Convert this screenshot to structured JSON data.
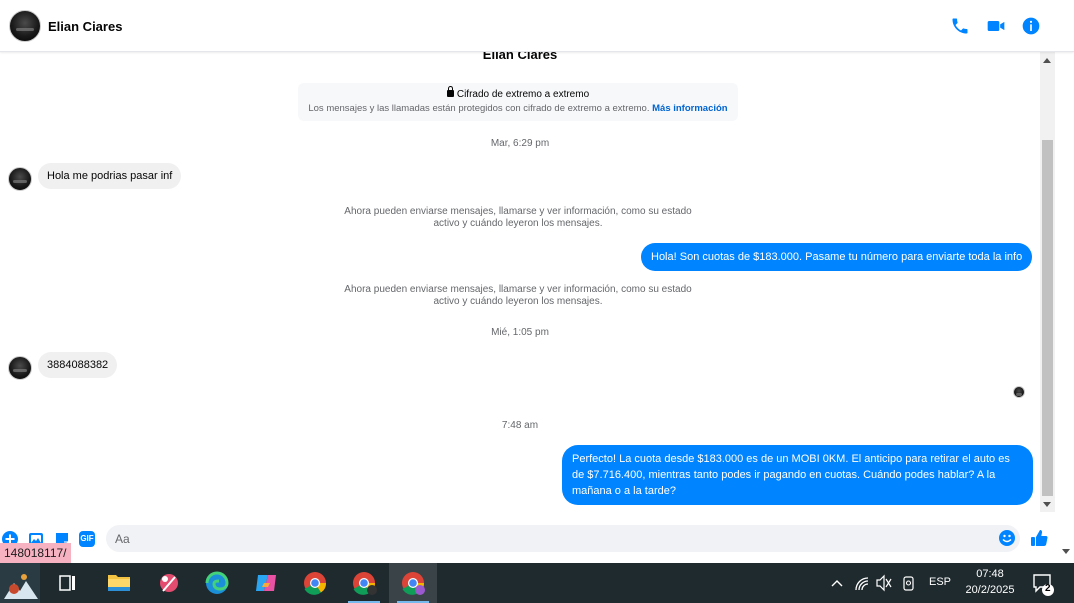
{
  "header": {
    "contact_name": "Elian Ciares",
    "icons": [
      "phone-icon",
      "video-camera-icon",
      "info-icon"
    ],
    "accent_color": "#0084ff"
  },
  "conversation": {
    "name": "Elian Ciares",
    "encryption": {
      "title": "Cifrado de extremo a extremo",
      "description": "Los mensajes y las llamadas están protegidos con cifrado de extremo a extremo.",
      "link": "Más información"
    },
    "timestamps": [
      "Mar, 6:29 pm",
      "Mié, 1:05 pm",
      "7:48 am"
    ],
    "system_notices": [
      "Ahora pueden enviarse mensajes, llamarse y ver información, como su estado activo y cuándo leyeron los mensajes.",
      "Ahora pueden enviarse mensajes, llamarse y ver información, como su estado activo y cuándo leyeron los mensajes."
    ],
    "messages": [
      {
        "direction": "incoming",
        "text": "Hola me podrias pasar inf"
      },
      {
        "direction": "outgoing",
        "text": "Hola! Son cuotas de $183.000. Pasame tu número para enviarte toda la info"
      },
      {
        "direction": "incoming",
        "text": "3884088382"
      },
      {
        "direction": "outgoing",
        "text": "Perfecto! La cuota desde $183.000 es de un MOBI 0KM. El anticipo para retirar el auto es de $7.716.400, mientras tanto podes ir pagando en cuotas. Cuándo podes hablar? A la mañana o a la tarde?"
      }
    ]
  },
  "composer": {
    "placeholder": "Aa",
    "icons": [
      "plus-icon",
      "image-icon",
      "sticker-icon",
      "gif-icon",
      "emoji-icon",
      "thumbs-up-icon"
    ],
    "gif_label": "GIF"
  },
  "status_url": "148018117/",
  "taskbar": {
    "apps": [
      "start-icon",
      "task-view-icon",
      "file-explorer-icon",
      "snipping-tool-icon",
      "edge-icon",
      "copilot-icon",
      "chrome-icon",
      "chrome-profile-icon",
      "chrome-active-icon"
    ],
    "tray_icons": [
      "chevron-up-icon",
      "wifi-icon",
      "speaker-muted-icon",
      "camera-icon"
    ],
    "language": "ESP",
    "time": "07:48",
    "date": "20/2/2025",
    "notification_count": "2",
    "taskbar_color": "#1f2a2e"
  }
}
